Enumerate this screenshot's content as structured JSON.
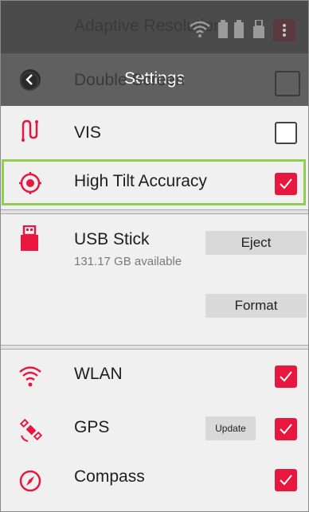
{
  "background_ghost": {
    "row1": "Adaptive Resolution",
    "row2": "Double Screen"
  },
  "header": {
    "title": "Settings",
    "back_icon": "chevron-left-icon"
  },
  "rows": {
    "vis": {
      "label": "VIS",
      "icon": "vis-path-icon",
      "checked": false
    },
    "high_tilt": {
      "label": "High Tilt Accuracy",
      "icon": "target-icon",
      "checked": true
    },
    "usb": {
      "label": "USB Stick",
      "icon": "usb-stick-icon",
      "available": "131.17 GB available",
      "eject_label": "Eject",
      "format_label": "Format"
    },
    "wlan": {
      "label": "WLAN",
      "icon": "wifi-icon",
      "checked": true
    },
    "gps": {
      "label": "GPS",
      "icon": "satellite-icon",
      "update_label": "Update",
      "checked": true
    },
    "compass": {
      "label": "Compass",
      "icon": "compass-icon",
      "checked": true
    }
  },
  "colors": {
    "accent": "#e8173f",
    "highlight": "#8fcd53",
    "header_bg": "#4b4b4b"
  }
}
